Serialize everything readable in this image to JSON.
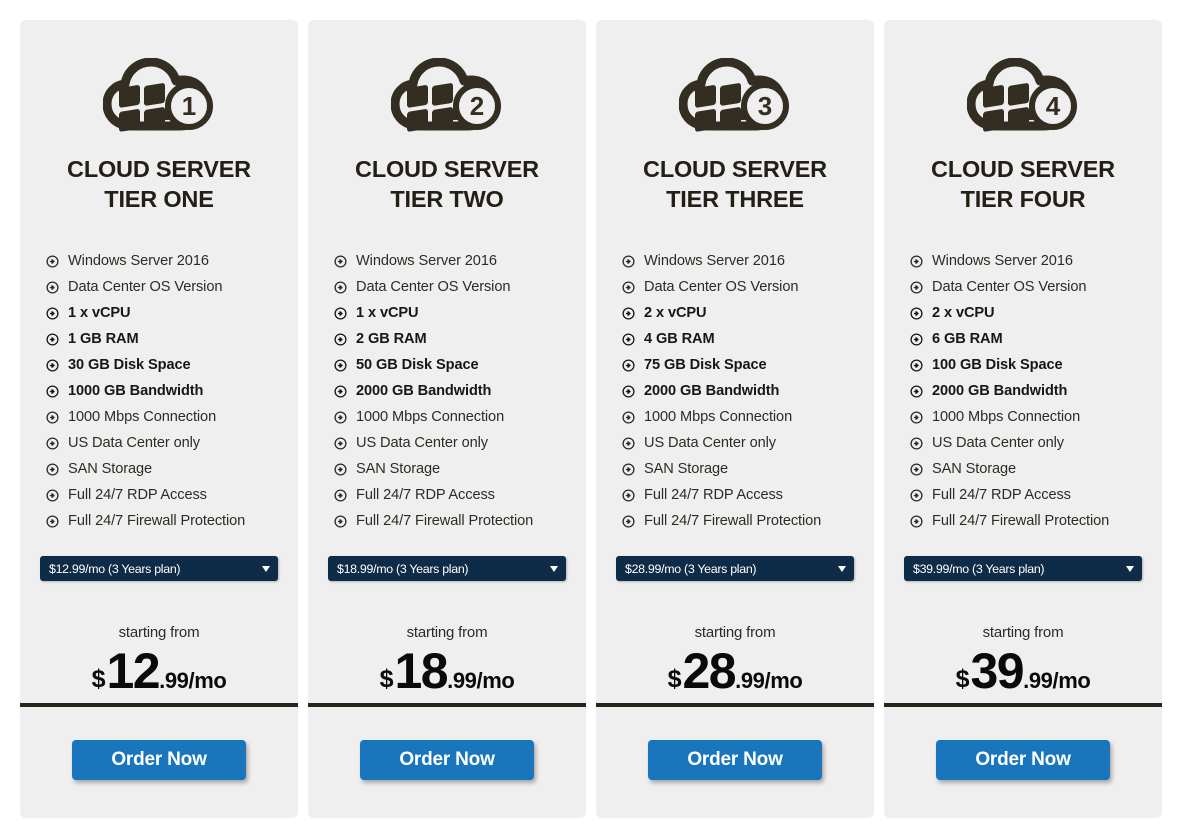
{
  "theme": {
    "page_background": "#ffffff",
    "card_background": "#efefef",
    "icon_color": "#332d22",
    "title_color": "#231f16",
    "select_background": "#0e2c47",
    "select_text": "#ffffff",
    "price_rule_color": "#2a231a",
    "order_button_color": "#1a76bc",
    "order_button_text": "#ffffff"
  },
  "labels": {
    "starting_from": "starting from",
    "order_now": "Order Now",
    "bullet_icon": "circle-arrow-right-icon",
    "cloud_icon": "cloud-windows-icon",
    "caret_icon": "chevron-down-icon"
  },
  "plans": [
    {
      "tier_number": "1",
      "title": "CLOUD SERVER\nTIER ONE",
      "features": [
        {
          "text": "Windows Server 2016",
          "bold": false
        },
        {
          "text": "Data Center OS Version",
          "bold": false
        },
        {
          "text": "1 x vCPU",
          "bold": true
        },
        {
          "text": "1 GB RAM",
          "bold": true
        },
        {
          "text": "30 GB Disk Space",
          "bold": true
        },
        {
          "text": "1000 GB Bandwidth",
          "bold": true
        },
        {
          "text": "1000 Mbps Connection",
          "bold": false
        },
        {
          "text": "US Data Center only",
          "bold": false
        },
        {
          "text": "SAN Storage",
          "bold": false
        },
        {
          "text": "Full 24/7 RDP Access",
          "bold": false
        },
        {
          "text": "Full 24/7 Firewall Protection",
          "bold": false
        }
      ],
      "selected_plan": "$12.99/mo (3 Years plan)",
      "price_currency": "$",
      "price_major": "12",
      "price_minor": ".99/mo"
    },
    {
      "tier_number": "2",
      "title": "CLOUD SERVER\nTIER TWO",
      "features": [
        {
          "text": "Windows Server 2016",
          "bold": false
        },
        {
          "text": "Data Center OS Version",
          "bold": false
        },
        {
          "text": "1 x vCPU",
          "bold": true
        },
        {
          "text": "2 GB RAM",
          "bold": true
        },
        {
          "text": "50 GB Disk Space",
          "bold": true
        },
        {
          "text": "2000 GB Bandwidth",
          "bold": true
        },
        {
          "text": "1000 Mbps Connection",
          "bold": false
        },
        {
          "text": "US Data Center only",
          "bold": false
        },
        {
          "text": "SAN Storage",
          "bold": false
        },
        {
          "text": "Full 24/7 RDP Access",
          "bold": false
        },
        {
          "text": "Full 24/7 Firewall Protection",
          "bold": false
        }
      ],
      "selected_plan": "$18.99/mo (3 Years plan)",
      "price_currency": "$",
      "price_major": "18",
      "price_minor": ".99/mo"
    },
    {
      "tier_number": "3",
      "title": "CLOUD SERVER\nTIER THREE",
      "features": [
        {
          "text": "Windows Server 2016",
          "bold": false
        },
        {
          "text": "Data Center OS Version",
          "bold": false
        },
        {
          "text": "2 x vCPU",
          "bold": true
        },
        {
          "text": "4 GB RAM",
          "bold": true
        },
        {
          "text": "75 GB Disk Space",
          "bold": true
        },
        {
          "text": "2000 GB Bandwidth",
          "bold": true
        },
        {
          "text": "1000 Mbps Connection",
          "bold": false
        },
        {
          "text": "US Data Center only",
          "bold": false
        },
        {
          "text": "SAN Storage",
          "bold": false
        },
        {
          "text": "Full 24/7 RDP Access",
          "bold": false
        },
        {
          "text": "Full 24/7 Firewall Protection",
          "bold": false
        }
      ],
      "selected_plan": "$28.99/mo (3 Years plan)",
      "price_currency": "$",
      "price_major": "28",
      "price_minor": ".99/mo"
    },
    {
      "tier_number": "4",
      "title": "CLOUD SERVER\nTIER FOUR",
      "features": [
        {
          "text": "Windows Server 2016",
          "bold": false
        },
        {
          "text": "Data Center OS Version",
          "bold": false
        },
        {
          "text": "2 x vCPU",
          "bold": true
        },
        {
          "text": "6 GB RAM",
          "bold": true
        },
        {
          "text": "100 GB Disk Space",
          "bold": true
        },
        {
          "text": "2000 GB Bandwidth",
          "bold": true
        },
        {
          "text": "1000 Mbps Connection",
          "bold": false
        },
        {
          "text": "US Data Center only",
          "bold": false
        },
        {
          "text": "SAN Storage",
          "bold": false
        },
        {
          "text": "Full 24/7 RDP Access",
          "bold": false
        },
        {
          "text": "Full 24/7 Firewall Protection",
          "bold": false
        }
      ],
      "selected_plan": "$39.99/mo (3 Years plan)",
      "price_currency": "$",
      "price_major": "39",
      "price_minor": ".99/mo"
    }
  ]
}
